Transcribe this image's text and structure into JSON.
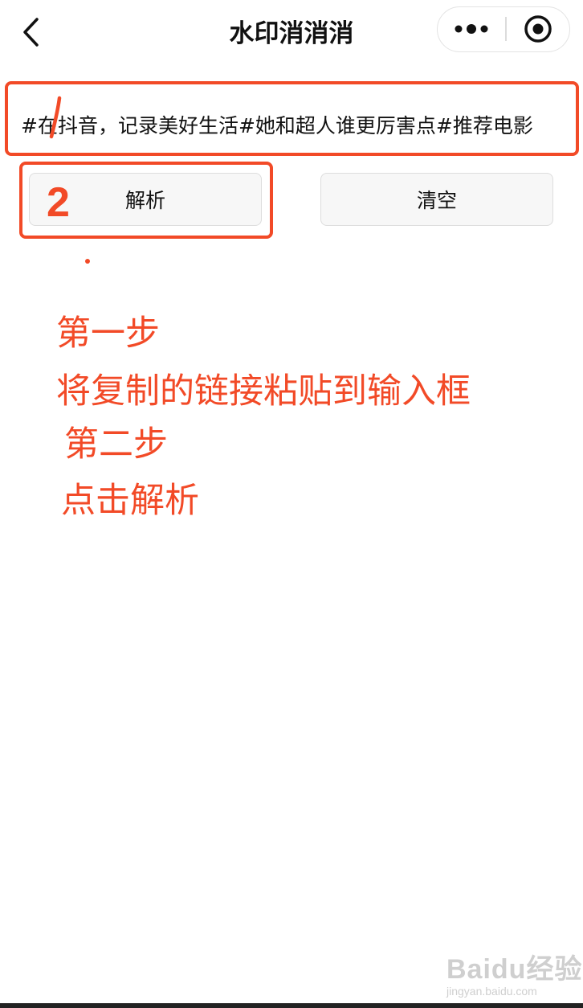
{
  "nav": {
    "title": "水印消消消",
    "back_icon": "chevron-left-icon",
    "more_icon": "more-dots-icon",
    "close_icon": "target-circle-icon"
  },
  "input": {
    "value": "#在抖音，记录美好生活#她和超人谁更厉害点#推荐电影",
    "placeholder": ""
  },
  "buttons": {
    "parse_label": "解析",
    "clear_label": "清空"
  },
  "annotations": {
    "mark_one": "1",
    "mark_two": "2",
    "step1_title": "第一步",
    "step1_text": "将复制的链接粘贴到输入框",
    "step2_title": "第二步",
    "step2_text": "点击解析",
    "color": "#f24a27"
  },
  "watermark": {
    "brand": "Baidu经验",
    "sub": "jingyan.baidu.com"
  }
}
